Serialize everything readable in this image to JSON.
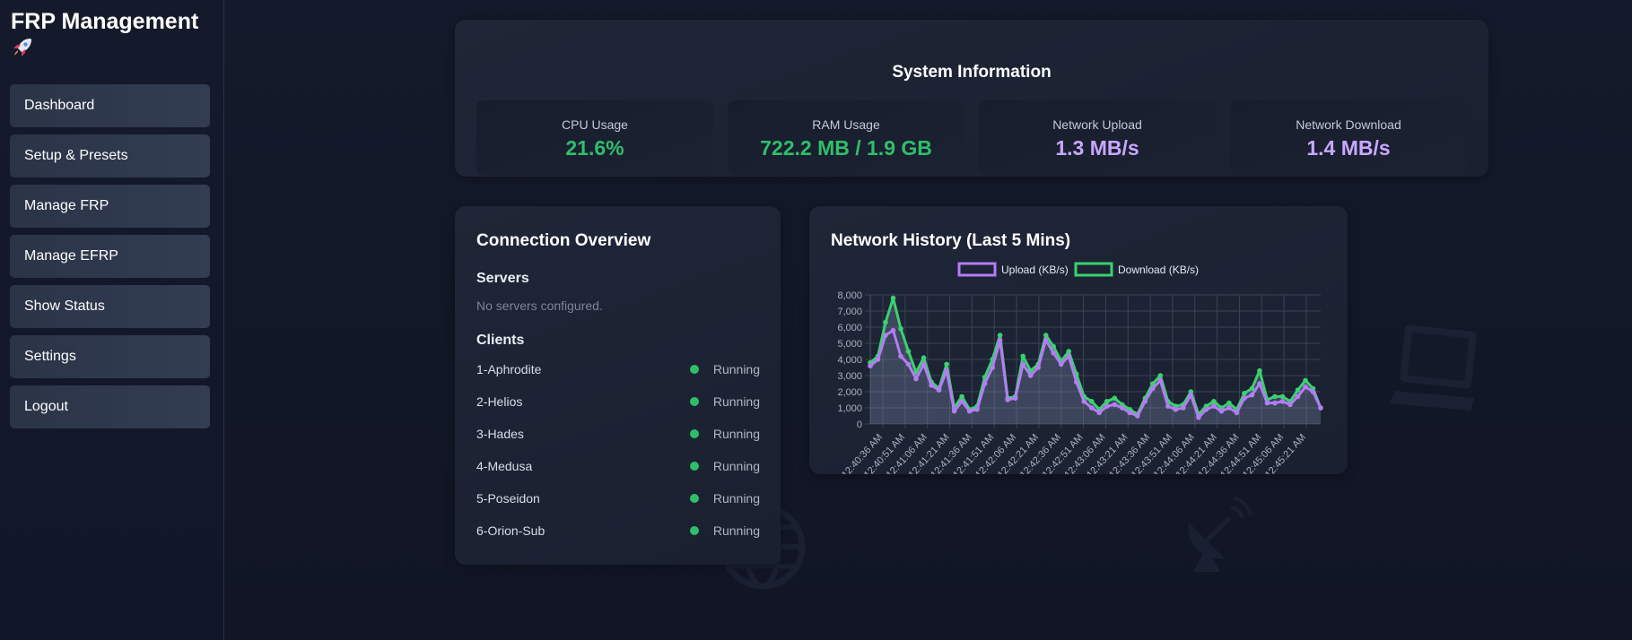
{
  "sidebar": {
    "brand": "FRP Management",
    "brand_icon": "rocket-icon",
    "items": [
      {
        "label": "Dashboard"
      },
      {
        "label": "Setup & Presets"
      },
      {
        "label": "Manage FRP"
      },
      {
        "label": "Manage EFRP"
      },
      {
        "label": "Show Status"
      },
      {
        "label": "Settings"
      },
      {
        "label": "Logout"
      }
    ]
  },
  "system": {
    "title": "System Information",
    "stats": [
      {
        "label": "CPU Usage",
        "value": "21.6%",
        "color": "#2fbf6a"
      },
      {
        "label": "RAM Usage",
        "value": "722.2 MB / 1.9 GB",
        "color": "#2fbf6a"
      },
      {
        "label": "Network Upload",
        "value": "1.3 MB/s",
        "color": "#c8a8ff"
      },
      {
        "label": "Network Download",
        "value": "1.4 MB/s",
        "color": "#c8a8ff"
      }
    ]
  },
  "connections": {
    "title": "Connection Overview",
    "servers_heading": "Servers",
    "servers_empty": "No servers configured.",
    "clients_heading": "Clients",
    "clients": [
      {
        "name": "1-Aphrodite",
        "status": "Running"
      },
      {
        "name": "2-Helios",
        "status": "Running"
      },
      {
        "name": "3-Hades",
        "status": "Running"
      },
      {
        "name": "4-Medusa",
        "status": "Running"
      },
      {
        "name": "5-Poseidon",
        "status": "Running"
      },
      {
        "name": "6-Orion-Sub",
        "status": "Running"
      }
    ]
  },
  "network": {
    "title": "Network History (Last 5 Mins)"
  },
  "chart_data": {
    "type": "line",
    "title": "Network History (Last 5 Mins)",
    "ylim": [
      0,
      8000
    ],
    "yticks": [
      "8,000",
      "7,000",
      "6,000",
      "5,000",
      "4,000",
      "3,000",
      "2,000",
      "1,000",
      "0"
    ],
    "grid": true,
    "legend_placement": "top-center",
    "x_tick_labels": [
      "12:40:36 AM",
      "12:40:51 AM",
      "12:41:06 AM",
      "12:41:21 AM",
      "12:41:36 AM",
      "12:41:51 AM",
      "12:42:06 AM",
      "12:42:21 AM",
      "12:42:36 AM",
      "12:42:51 AM",
      "12:43:06 AM",
      "12:43:21 AM",
      "12:43:36 AM",
      "12:43:51 AM",
      "12:44:06 AM",
      "12:44:21 AM",
      "12:44:36 AM",
      "12:44:51 AM",
      "12:45:06 AM",
      "12:45:21 AM"
    ],
    "series": [
      {
        "name": "Upload (KB/s)",
        "color": "#b47cf5",
        "values": [
          3600,
          4000,
          5500,
          5800,
          4200,
          3700,
          2800,
          3700,
          2400,
          2100,
          3300,
          800,
          1400,
          800,
          900,
          2500,
          3500,
          5200,
          1500,
          1600,
          3700,
          3000,
          3500,
          5200,
          4400,
          3700,
          4200,
          2600,
          1400,
          1000,
          700,
          1100,
          1200,
          1000,
          700,
          500,
          1400,
          2200,
          2700,
          1100,
          900,
          1000,
          1800,
          400,
          900,
          1100,
          800,
          1000,
          700,
          1600,
          1800,
          2500,
          1300,
          1300,
          1400,
          1200,
          1700,
          2300,
          2000,
          1000
        ]
      },
      {
        "name": "Download (KB/s)",
        "color": "#3bd16f",
        "values": [
          3800,
          4200,
          6300,
          7800,
          5900,
          4500,
          3200,
          4100,
          2600,
          2200,
          3700,
          1000,
          1700,
          900,
          1100,
          2900,
          4000,
          5500,
          1600,
          1700,
          4200,
          3300,
          3700,
          5500,
          4800,
          3900,
          4500,
          3100,
          1700,
          1400,
          900,
          1400,
          1600,
          1200,
          900,
          600,
          1600,
          2500,
          3000,
          1400,
          1100,
          1200,
          2000,
          600,
          1100,
          1400,
          1000,
          1300,
          900,
          1900,
          2200,
          3300,
          1500,
          1700,
          1700,
          1400,
          2100,
          2700,
          2200,
          1000
        ]
      }
    ]
  }
}
